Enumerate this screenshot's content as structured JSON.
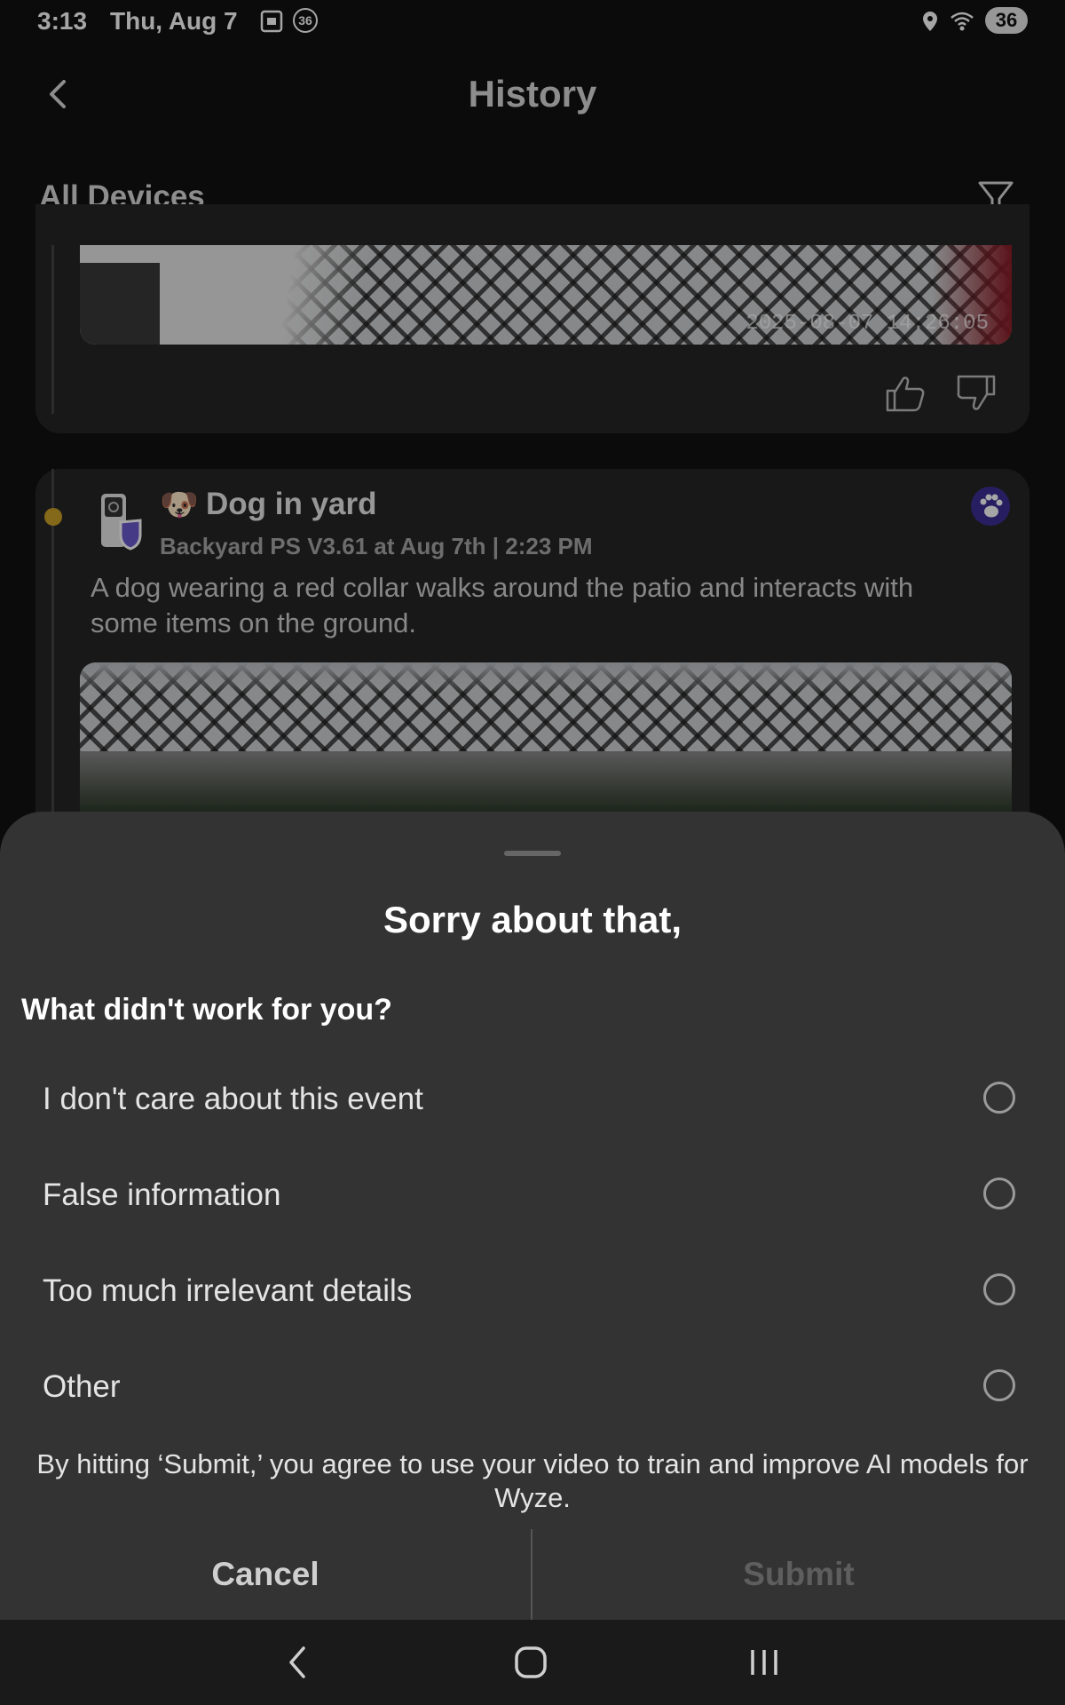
{
  "status_bar": {
    "time": "3:13",
    "date": "Thu, Aug 7",
    "notification_badge": "36",
    "battery": "36"
  },
  "header": {
    "title": "History",
    "devices_filter_label": "All Devices"
  },
  "events": [
    {
      "thumbnail_timestamp": "2025-08-07 14:26:05",
      "icons": [
        "thumbs-up-icon",
        "thumbs-down-icon"
      ]
    },
    {
      "emoji": "🐶",
      "title": "Dog in yard",
      "subtitle": "Backyard PS V3.61 at Aug 7th | 2:23 PM",
      "description": "A dog wearing a red collar walks around the patio and interacts with some items on the ground.",
      "badge_icon": "paw-icon",
      "dot_color": "#c9a227"
    }
  ],
  "feedback_sheet": {
    "title": "Sorry about that,",
    "question": "What didn't work for you?",
    "options": [
      {
        "label": "I don't care about this event",
        "selected": false
      },
      {
        "label": "False information",
        "selected": false
      },
      {
        "label": "Too much irrelevant details",
        "selected": false
      },
      {
        "label": "Other",
        "selected": false
      }
    ],
    "consent_text": "By hitting ‘Submit,’ you agree to use your video to train and improve AI models for Wyze.",
    "cancel_label": "Cancel",
    "submit_label": "Submit",
    "submit_enabled": false
  },
  "colors": {
    "paw_badge": "#3d2f96",
    "sheet_background": "#333333"
  }
}
